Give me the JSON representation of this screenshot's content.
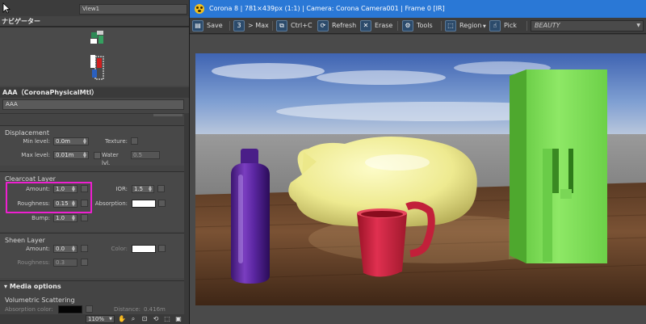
{
  "app": {
    "viewport_label": "View1",
    "navigator_title": "ナビゲーター",
    "material_title": "AAA（CoronaPhysicalMtl）",
    "material_name": "AAA"
  },
  "displacement": {
    "title": "Displacement",
    "min_level_label": "Min level:",
    "min_level_value": "0.0m",
    "max_level_label": "Max level:",
    "max_level_value": "0.01m",
    "texture_label": "Texture:",
    "water_lvl_label": "Water lvl.",
    "water_lvl_value": "0.5"
  },
  "clearcoat": {
    "title": "Clearcoat Layer",
    "amount_label": "Amount:",
    "amount_value": "1.0",
    "roughness_label": "Roughness:",
    "roughness_value": "0.15",
    "bump_label": "Bump:",
    "bump_value": "1.0",
    "ior_label": "IOR:",
    "ior_value": "1.5",
    "absorption_label": "Absorption:"
  },
  "sheen": {
    "title": "Sheen Layer",
    "amount_label": "Amount:",
    "amount_value": "0.0",
    "roughness_label": "Roughness:",
    "roughness_value": "0.3",
    "color_label": "Color:"
  },
  "media": {
    "title": "Media options",
    "volumetric_title": "Volumetric Scattering",
    "absorption_color_label": "Absorption color:",
    "distance_label": "Distance:",
    "distance_value": "0.416m"
  },
  "statusbar": {
    "zoom": "110%"
  },
  "vfb": {
    "title": "Corona 8 | 781×439px (1:1) | Camera: Corona Camera001 | Frame 0 [IR]",
    "toolbar": {
      "save": "Save",
      "to_max": "> Max",
      "copy": "Ctrl+C",
      "refresh": "Refresh",
      "erase": "Erase",
      "tools": "Tools",
      "region": "Region",
      "pick": "Pick"
    },
    "render_pass": "BEAUTY"
  },
  "colors": {
    "highlight": "#ee1fd0",
    "title_bar": "#2a78d6",
    "bottle": "#6a2aa8",
    "cat": "#f0ee9a",
    "mug": "#d82840",
    "green_block": "#7de05a"
  }
}
